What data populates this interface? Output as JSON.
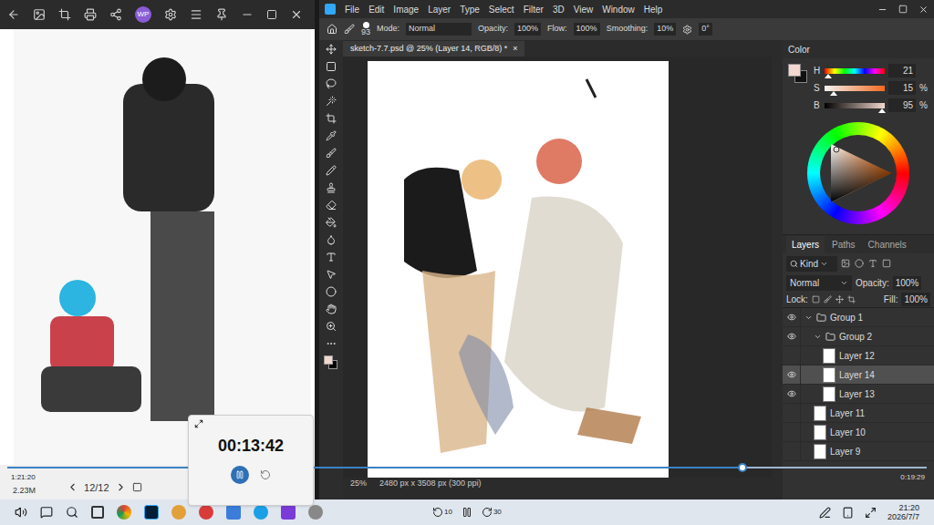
{
  "viewer": {
    "badge": "WP",
    "size": "2.23M",
    "counter": "12/12"
  },
  "photoshop": {
    "menu": [
      "File",
      "Edit",
      "Image",
      "Layer",
      "Type",
      "Select",
      "Filter",
      "3D",
      "View",
      "Window",
      "Help"
    ],
    "options": {
      "brush_size": "93",
      "mode_label": "Mode:",
      "mode": "Normal",
      "opacity_label": "Opacity:",
      "opacity": "100%",
      "flow_label": "Flow:",
      "flow": "100%",
      "smoothing_label": "Smoothing:",
      "smoothing": "10%",
      "angle": "0°"
    },
    "tab": {
      "title": "sketch-7.7.psd @ 25% (Layer 14, RGB/8) *",
      "close": "×"
    },
    "status": {
      "zoom": "25%",
      "size": "2480 px x 3508 px (300 ppi)"
    },
    "color_panel": {
      "title": "Color",
      "channels": [
        {
          "name": "H",
          "value": "21",
          "unit": "",
          "level": 0.06
        },
        {
          "name": "S",
          "value": "15",
          "unit": "%",
          "level": 0.15
        },
        {
          "name": "B",
          "value": "95",
          "unit": "%",
          "level": 0.95
        }
      ]
    },
    "layers_panel": {
      "tabs": [
        {
          "label": "Layers",
          "selected": true
        },
        {
          "label": "Paths",
          "selected": false
        },
        {
          "label": "Channels",
          "selected": false
        }
      ],
      "filter": "Kind",
      "blend": "Normal",
      "opacity_label": "Opacity:",
      "opacity": "100%",
      "lock_label": "Lock:",
      "fill_label": "Fill:",
      "fill": "100%",
      "layers": [
        {
          "name": "Group 1",
          "kind": "group",
          "depth": 0,
          "expanded": true,
          "visible": true,
          "selected": false
        },
        {
          "name": "Group 2",
          "kind": "group",
          "depth": 1,
          "expanded": true,
          "visible": true,
          "selected": false
        },
        {
          "name": "Layer 12",
          "kind": "layer",
          "depth": 2,
          "expanded": false,
          "visible": false,
          "selected": false
        },
        {
          "name": "Layer 14",
          "kind": "layer",
          "depth": 2,
          "expanded": false,
          "visible": true,
          "selected": true
        },
        {
          "name": "Layer 13",
          "kind": "layer",
          "depth": 2,
          "expanded": false,
          "visible": true,
          "selected": false
        },
        {
          "name": "Layer 11",
          "kind": "layer",
          "depth": 1,
          "expanded": false,
          "visible": false,
          "selected": false
        },
        {
          "name": "Layer 10",
          "kind": "layer",
          "depth": 1,
          "expanded": false,
          "visible": false,
          "selected": false
        },
        {
          "name": "Layer 9",
          "kind": "layer",
          "depth": 1,
          "expanded": false,
          "visible": false,
          "selected": false
        }
      ]
    }
  },
  "player": {
    "elapsed": "1:21:20",
    "remaining": "0:19:29",
    "level": 0.8,
    "back": "10",
    "forward": "30"
  },
  "timer": {
    "time": "00:13:42"
  },
  "taskbar": {
    "time": "21:20",
    "date": "2026/7/7"
  }
}
